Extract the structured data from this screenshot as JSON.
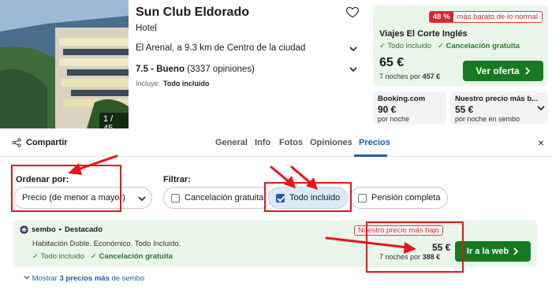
{
  "hotel": {
    "name": "Sun Club Eldorado",
    "type": "Hotel",
    "location": "El Arenal, a 9.3 km de Centro de la ciudad",
    "rating_score": "7.5 - Bueno",
    "rating_count": "(3337 opiniones)",
    "includes_label": "Incluye:",
    "includes_value": "Todo incluido",
    "photo_counter": "1 / 45"
  },
  "top_offer": {
    "discount_pct": "48 %",
    "discount_text": "más barato de lo normal",
    "provider": "Viajes El Corte Inglés",
    "feature_1": "✓ Todo incluido",
    "feature_2": "✓ Cancelación gratuita",
    "price": "65 €",
    "nights_prefix": "7 noches por",
    "nights_total": "457 €",
    "cta": "Ver oferta"
  },
  "alt_offers": [
    {
      "provider": "Booking.com",
      "price": "90 €",
      "note": "por noche"
    },
    {
      "provider": "Nuestro precio más b...",
      "price": "55 €",
      "note": "por noche en sembo"
    }
  ],
  "tabs": {
    "share": "Compartir",
    "general": "General",
    "info": "Info",
    "photos": "Fotos",
    "reviews": "Opiniones",
    "prices": "Precios",
    "close": "×"
  },
  "filters": {
    "sort_label": "Ordenar por:",
    "sort_value": "Precio (de menor a mayor)",
    "filter_label": "Filtrar:",
    "free_cancel": "Cancelación gratuita",
    "all_inclusive": "Todo incluido",
    "full_board": "Pensión completa"
  },
  "deal": {
    "provider": "sembo",
    "tag": "Destacado",
    "description": "Habitación Doble. Económico. Todo Incluido.",
    "feature_1": "✓ Todo incluido",
    "feature_2": "✓ Cancelación gratuita",
    "badge": "Nuestro precio más bajo",
    "price": "55 €",
    "nights_prefix": "7 noches por",
    "nights_total": "388 €",
    "cta": "Ir a la web"
  },
  "more_prices": {
    "prefix": "Mostrar",
    "count": "3 precios más",
    "suffix": "de sembo"
  },
  "colors": {
    "accent": "#1a5fb4",
    "green": "#177a22",
    "annotation": "#e8141a"
  }
}
